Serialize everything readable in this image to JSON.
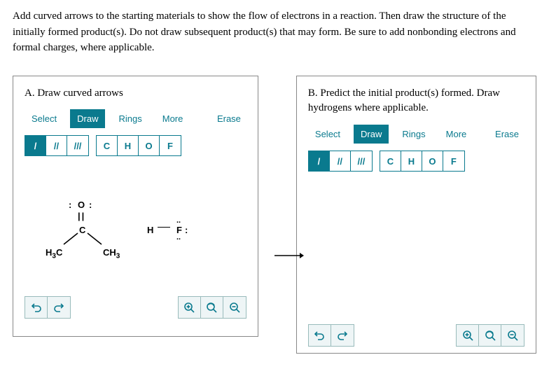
{
  "instructions": "Add curved arrows to the starting materials to show the flow of electrons in a reaction. Then draw the structure of the initially formed product(s). Do not draw subsequent product(s) that may form. Be sure to add nonbonding electrons and formal charges, where applicable.",
  "panel_a": {
    "title": "A. Draw curved arrows",
    "tabs": {
      "select": "Select",
      "draw": "Draw",
      "rings": "Rings",
      "more": "More"
    },
    "erase": "Erase",
    "bond_tools": [
      "/",
      "//",
      "///"
    ],
    "atom_tools": [
      "C",
      "H",
      "O",
      "F"
    ],
    "molecule": {
      "o_dots_left": ":",
      "o_label": "O",
      "o_dots_right": ":",
      "c_label": "C",
      "left_ch3": "H₃C",
      "right_ch3": "CH₃",
      "hf_h": "H",
      "hf_f": "F",
      "hf_dots_upper": "..",
      "hf_dots_right": ":",
      "hf_dots_lower": ".."
    }
  },
  "panel_b": {
    "title": "B. Predict the initial product(s) formed. Draw hydrogens where applicable.",
    "tabs": {
      "select": "Select",
      "draw": "Draw",
      "rings": "Rings",
      "more": "More"
    },
    "erase": "Erase",
    "bond_tools": [
      "/",
      "//",
      "///"
    ],
    "atom_tools": [
      "C",
      "H",
      "O",
      "F"
    ]
  },
  "arrow": "→",
  "icons": {
    "undo": "↶",
    "redo": "↷",
    "zoom_in": "⊕",
    "reset_zoom": "⟲",
    "zoom_out": "⊖"
  },
  "chart_data": {
    "type": "chemical_structure_editor",
    "reactant_1": {
      "species": "acetone",
      "formula": "(CH3)2C=O",
      "atoms": [
        "O",
        "C",
        "CH3",
        "CH3"
      ],
      "lone_pairs": {
        "O": 2
      },
      "bonds": [
        [
          "C",
          "O",
          "double"
        ],
        [
          "C",
          "CH3",
          "single"
        ],
        [
          "C",
          "CH3",
          "single"
        ]
      ]
    },
    "reactant_2": {
      "species": "HF",
      "formula": "H-F",
      "atoms": [
        "H",
        "F"
      ],
      "lone_pairs": {
        "F": 3
      },
      "bonds": [
        [
          "H",
          "F",
          "single"
        ]
      ]
    },
    "task": "draw curved arrows and initial product(s)"
  }
}
